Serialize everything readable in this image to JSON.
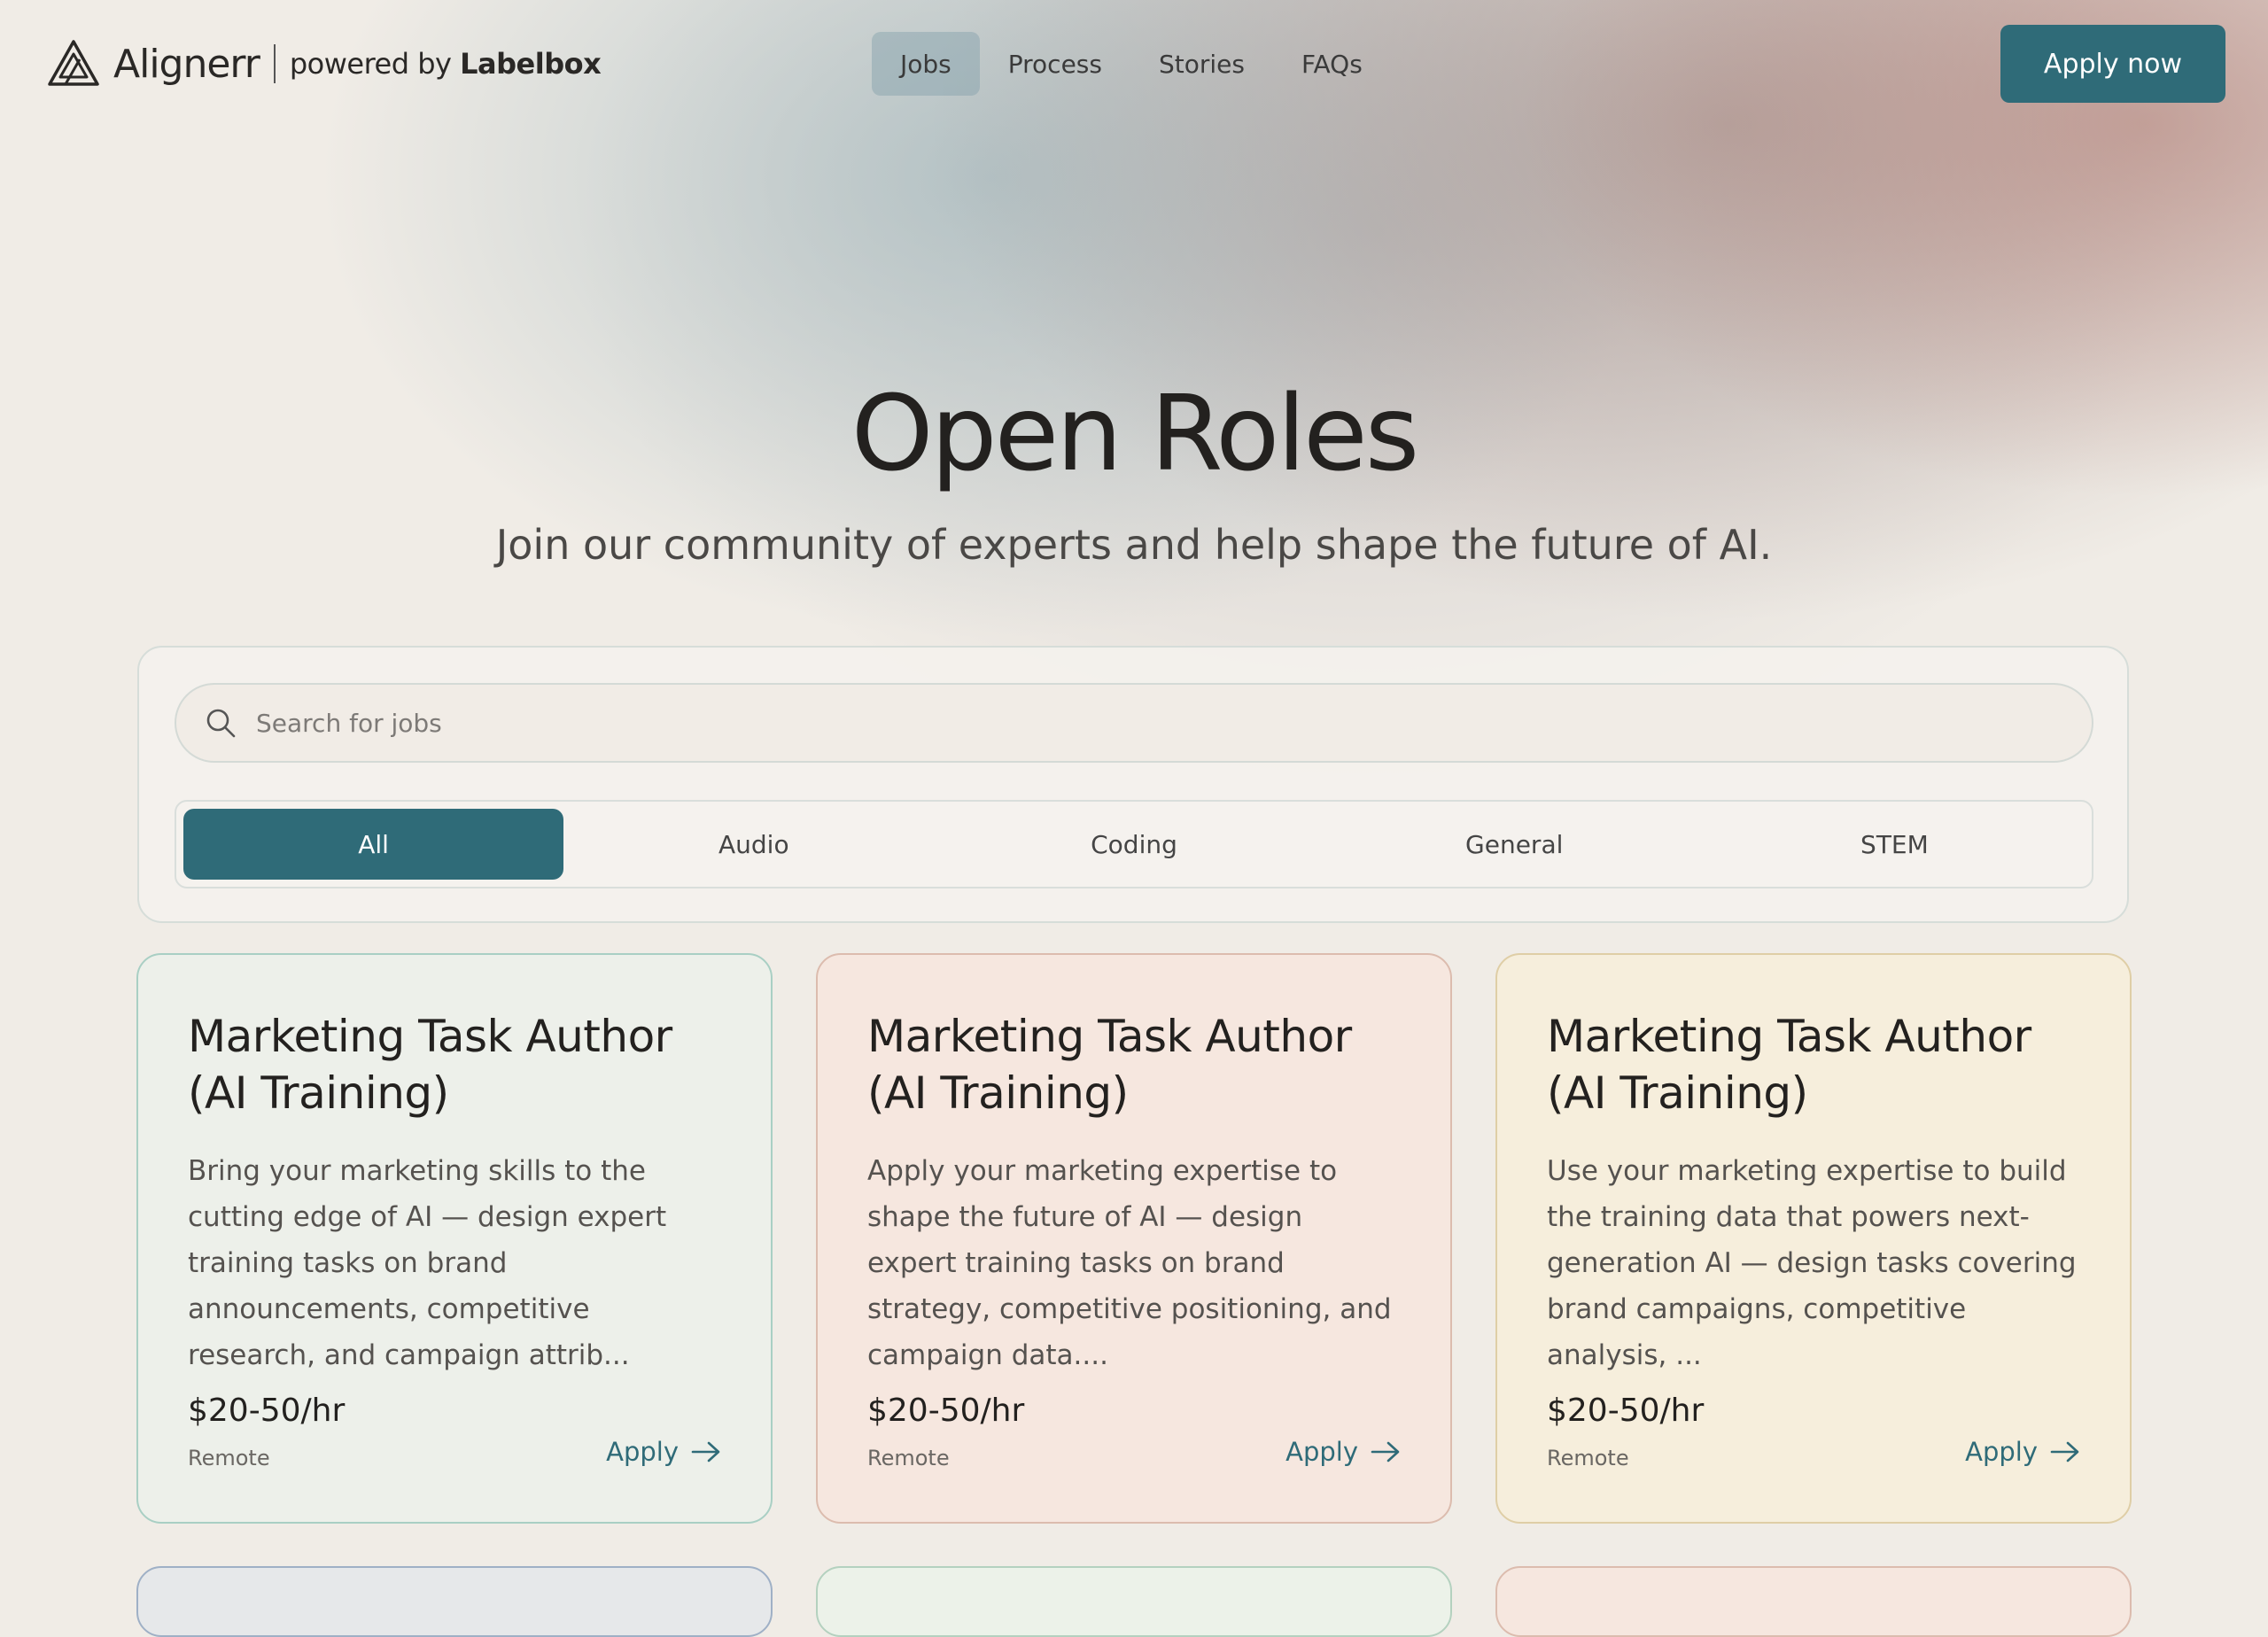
{
  "header": {
    "brand_name": "Alignerr",
    "powered_prefix": "powered by",
    "powered_brand": "Labelbox",
    "nav": [
      {
        "label": "Jobs",
        "active": true
      },
      {
        "label": "Process",
        "active": false
      },
      {
        "label": "Stories",
        "active": false
      },
      {
        "label": "FAQs",
        "active": false
      }
    ],
    "cta_label": "Apply now"
  },
  "hero": {
    "title": "Open Roles",
    "subtitle": "Join our community of experts and help shape the future of AI."
  },
  "search": {
    "placeholder": "Search for jobs",
    "value": ""
  },
  "filters": [
    {
      "label": "All",
      "active": true
    },
    {
      "label": "Audio",
      "active": false
    },
    {
      "label": "Coding",
      "active": false
    },
    {
      "label": "General",
      "active": false
    },
    {
      "label": "STEM",
      "active": false
    }
  ],
  "jobs": [
    {
      "title": "Marketing Task Author (AI Training)",
      "description": "Bring your marketing skills to the cutting edge of AI — design expert training tasks on brand announcements, competitive research, and campaign attrib...",
      "rate": "$20-50/hr",
      "location": "Remote",
      "apply_label": "Apply"
    },
    {
      "title": "Marketing Task Author (AI Training)",
      "description": "Apply your marketing expertise to shape the future of AI — design expert training tasks on brand strategy, competitive positioning, and campaign data....",
      "rate": "$20-50/hr",
      "location": "Remote",
      "apply_label": "Apply"
    },
    {
      "title": "Marketing Task Author (AI Training)",
      "description": "Use your marketing expertise to build the training data that powers next-generation AI — design tasks covering brand campaigns, competitive analysis, ...",
      "rate": "$20-50/hr",
      "location": "Remote",
      "apply_label": "Apply"
    }
  ],
  "colors": {
    "accent": "#2f6b78",
    "background": "#f0ece6",
    "card_green": "#edf0ea",
    "card_peach": "#f6e7df",
    "card_cream": "#f6eedc"
  },
  "icons": {
    "logo": "alignerr-logo-icon",
    "search": "search-icon",
    "apply_arrow": "arrow-right-icon"
  }
}
